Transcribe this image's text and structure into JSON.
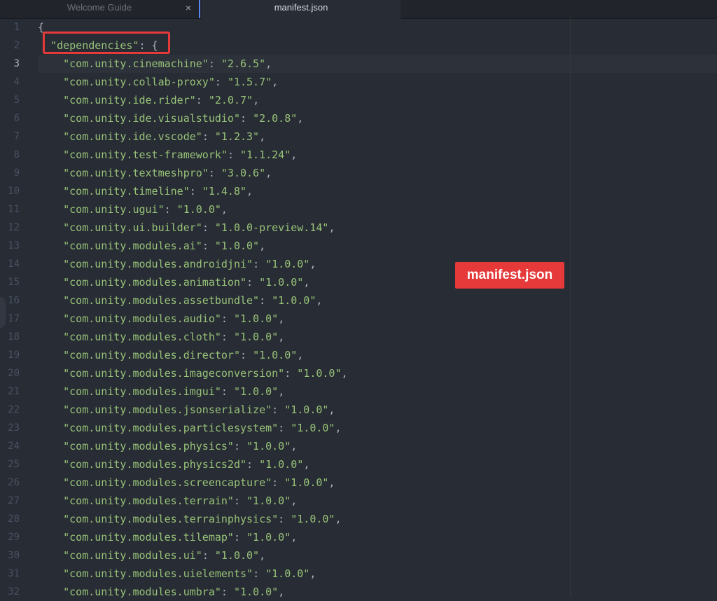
{
  "tabs": [
    {
      "label": "Welcome Guide",
      "active": false
    },
    {
      "label": "manifest.json",
      "active": true
    }
  ],
  "tab_close_icon": "×",
  "annotation": {
    "label": "manifest.json",
    "color": "#e5393a"
  },
  "editor": {
    "active_line": 3,
    "lines": [
      {
        "n": "1",
        "indent": "",
        "key": "",
        "value": "",
        "text": "{"
      },
      {
        "n": "2",
        "indent": "  ",
        "key": "\"dependencies\"",
        "value": "",
        "text": ": {"
      },
      {
        "n": "3",
        "indent": "    ",
        "key": "\"com.unity.cinemachine\"",
        "value": "\"2.6.5\"",
        "text": ","
      },
      {
        "n": "4",
        "indent": "    ",
        "key": "\"com.unity.collab-proxy\"",
        "value": "\"1.5.7\"",
        "text": ","
      },
      {
        "n": "5",
        "indent": "    ",
        "key": "\"com.unity.ide.rider\"",
        "value": "\"2.0.7\"",
        "text": ","
      },
      {
        "n": "6",
        "indent": "    ",
        "key": "\"com.unity.ide.visualstudio\"",
        "value": "\"2.0.8\"",
        "text": ","
      },
      {
        "n": "7",
        "indent": "    ",
        "key": "\"com.unity.ide.vscode\"",
        "value": "\"1.2.3\"",
        "text": ","
      },
      {
        "n": "8",
        "indent": "    ",
        "key": "\"com.unity.test-framework\"",
        "value": "\"1.1.24\"",
        "text": ","
      },
      {
        "n": "9",
        "indent": "    ",
        "key": "\"com.unity.textmeshpro\"",
        "value": "\"3.0.6\"",
        "text": ","
      },
      {
        "n": "10",
        "indent": "    ",
        "key": "\"com.unity.timeline\"",
        "value": "\"1.4.8\"",
        "text": ","
      },
      {
        "n": "11",
        "indent": "    ",
        "key": "\"com.unity.ugui\"",
        "value": "\"1.0.0\"",
        "text": ","
      },
      {
        "n": "12",
        "indent": "    ",
        "key": "\"com.unity.ui.builder\"",
        "value": "\"1.0.0-preview.14\"",
        "text": ","
      },
      {
        "n": "13",
        "indent": "    ",
        "key": "\"com.unity.modules.ai\"",
        "value": "\"1.0.0\"",
        "text": ","
      },
      {
        "n": "14",
        "indent": "    ",
        "key": "\"com.unity.modules.androidjni\"",
        "value": "\"1.0.0\"",
        "text": ","
      },
      {
        "n": "15",
        "indent": "    ",
        "key": "\"com.unity.modules.animation\"",
        "value": "\"1.0.0\"",
        "text": ","
      },
      {
        "n": "16",
        "indent": "    ",
        "key": "\"com.unity.modules.assetbundle\"",
        "value": "\"1.0.0\"",
        "text": ","
      },
      {
        "n": "17",
        "indent": "    ",
        "key": "\"com.unity.modules.audio\"",
        "value": "\"1.0.0\"",
        "text": ","
      },
      {
        "n": "18",
        "indent": "    ",
        "key": "\"com.unity.modules.cloth\"",
        "value": "\"1.0.0\"",
        "text": ","
      },
      {
        "n": "19",
        "indent": "    ",
        "key": "\"com.unity.modules.director\"",
        "value": "\"1.0.0\"",
        "text": ","
      },
      {
        "n": "20",
        "indent": "    ",
        "key": "\"com.unity.modules.imageconversion\"",
        "value": "\"1.0.0\"",
        "text": ","
      },
      {
        "n": "21",
        "indent": "    ",
        "key": "\"com.unity.modules.imgui\"",
        "value": "\"1.0.0\"",
        "text": ","
      },
      {
        "n": "22",
        "indent": "    ",
        "key": "\"com.unity.modules.jsonserialize\"",
        "value": "\"1.0.0\"",
        "text": ","
      },
      {
        "n": "23",
        "indent": "    ",
        "key": "\"com.unity.modules.particlesystem\"",
        "value": "\"1.0.0\"",
        "text": ","
      },
      {
        "n": "24",
        "indent": "    ",
        "key": "\"com.unity.modules.physics\"",
        "value": "\"1.0.0\"",
        "text": ","
      },
      {
        "n": "25",
        "indent": "    ",
        "key": "\"com.unity.modules.physics2d\"",
        "value": "\"1.0.0\"",
        "text": ","
      },
      {
        "n": "26",
        "indent": "    ",
        "key": "\"com.unity.modules.screencapture\"",
        "value": "\"1.0.0\"",
        "text": ","
      },
      {
        "n": "27",
        "indent": "    ",
        "key": "\"com.unity.modules.terrain\"",
        "value": "\"1.0.0\"",
        "text": ","
      },
      {
        "n": "28",
        "indent": "    ",
        "key": "\"com.unity.modules.terrainphysics\"",
        "value": "\"1.0.0\"",
        "text": ","
      },
      {
        "n": "29",
        "indent": "    ",
        "key": "\"com.unity.modules.tilemap\"",
        "value": "\"1.0.0\"",
        "text": ","
      },
      {
        "n": "30",
        "indent": "    ",
        "key": "\"com.unity.modules.ui\"",
        "value": "\"1.0.0\"",
        "text": ","
      },
      {
        "n": "31",
        "indent": "    ",
        "key": "\"com.unity.modules.uielements\"",
        "value": "\"1.0.0\"",
        "text": ","
      },
      {
        "n": "32",
        "indent": "    ",
        "key": "\"com.unity.modules.umbra\"",
        "value": "\"1.0.0\"",
        "text": ","
      }
    ]
  }
}
